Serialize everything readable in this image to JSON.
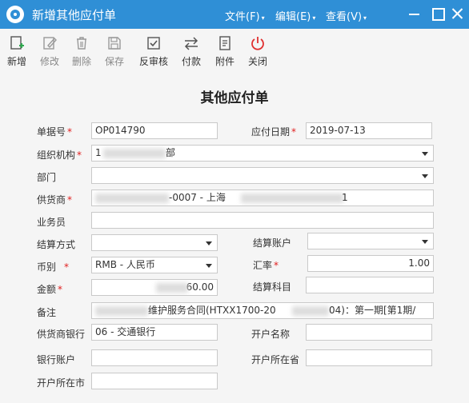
{
  "window": {
    "title": "新增其他应付单",
    "menus": [
      {
        "label": "文件(F)"
      },
      {
        "label": "编辑(E)"
      },
      {
        "label": "查看(V)"
      }
    ]
  },
  "toolbar": {
    "items": [
      {
        "label": "新增",
        "icon": "new-doc-icon"
      },
      {
        "label": "修改",
        "icon": "edit-icon"
      },
      {
        "label": "删除",
        "icon": "trash-icon"
      },
      {
        "label": "保存",
        "icon": "save-icon"
      },
      {
        "label": "反审核",
        "icon": "unaudit-icon"
      },
      {
        "label": "付款",
        "icon": "transfer-icon"
      },
      {
        "label": "附件",
        "icon": "attachment-icon"
      },
      {
        "label": "关闭",
        "icon": "power-icon"
      }
    ]
  },
  "form": {
    "title": "其他应付单",
    "doc_no_label": "单据号",
    "doc_no": "OP014790",
    "pay_date_label": "应付日期",
    "pay_date": "2019-07-13",
    "org_label": "组织机构",
    "org_value": "1",
    "org_value_tail": "部",
    "dept_label": "部门",
    "dept_value": "",
    "supplier_label": "供货商",
    "supplier_value": "-0007 - 上海",
    "supplier_tail": "1",
    "salesman_label": "业务员",
    "salesman_value": "",
    "settle_method_label": "结算方式",
    "settle_method_value": "",
    "settle_account_label": "结算账户",
    "settle_account_value": "",
    "currency_label": "币别",
    "currency_value": "RMB - 人民币",
    "rate_label": "汇率",
    "rate_value": "1.00",
    "amount_label": "金额",
    "amount_value": "60.00",
    "subject_label": "结算科目",
    "subject_value": "",
    "remark_label": "备注",
    "remark_value": "维护服务合同(HTXX1700-20",
    "remark_tail": "04)：第一期[第1期/",
    "supplier_bank_label": "供货商银行",
    "supplier_bank_value": "06 - 交通银行",
    "account_name_label": "开户名称",
    "account_name_value": "",
    "bank_account_label": "银行账户",
    "bank_account_value": "",
    "open_province_label": "开户所在省",
    "open_province_value": "",
    "open_city_label": "开户所在市",
    "open_city_value": "",
    "required_mark": "*"
  },
  "colors": {
    "titlebar": "#2f8fd6",
    "required": "#e02020",
    "close_icon": "#e03030",
    "new_icon_accent": "#2fa84f"
  }
}
